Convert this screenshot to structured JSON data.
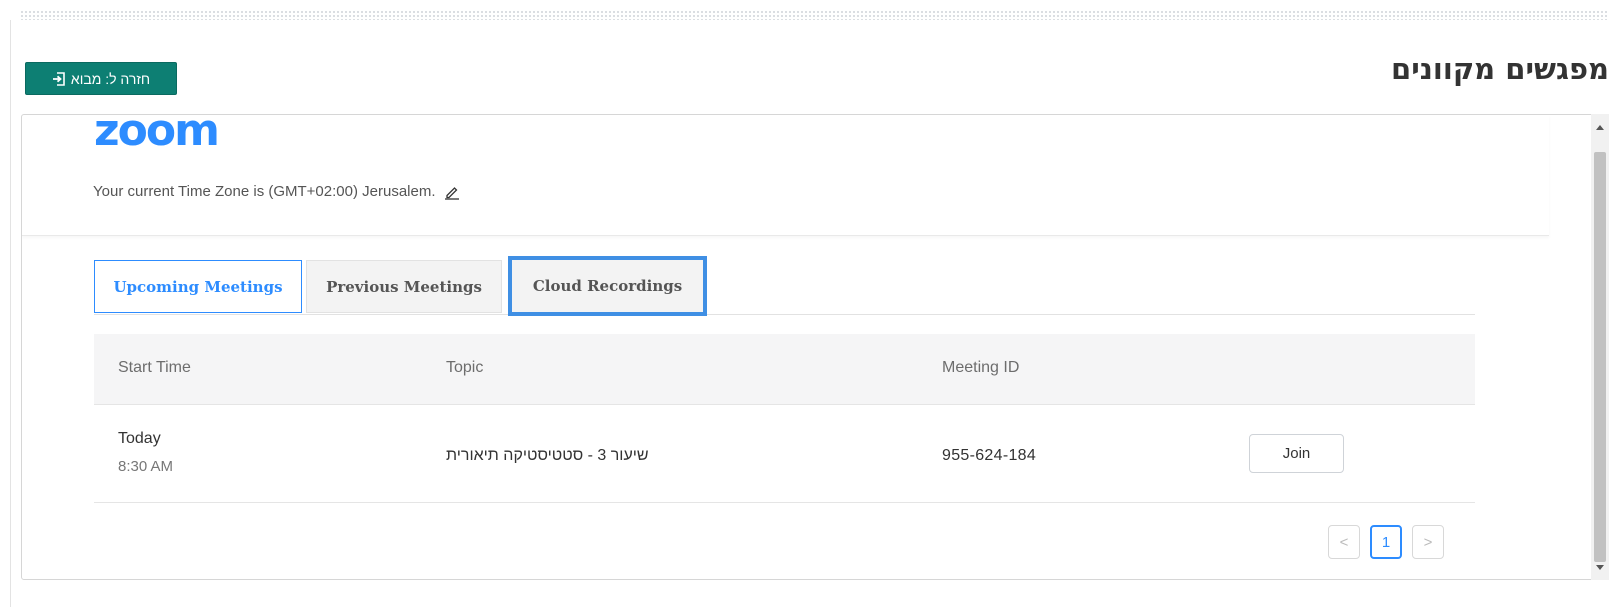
{
  "page": {
    "title": "מפגשים מקוונים",
    "back_button": {
      "label": "חזרה ל: מבוא",
      "icon": "sign-in-icon",
      "color": "#0d7f73"
    }
  },
  "zoom": {
    "logo": "zoom",
    "logo_color": "#2d8cff",
    "timezone_text": "Your current Time Zone is (GMT+02:00) Jerusalem.",
    "edit_icon": "pencil-icon"
  },
  "tabs": [
    {
      "label": "Upcoming Meetings",
      "state": "active"
    },
    {
      "label": "Previous Meetings",
      "state": "inactive"
    },
    {
      "label": "Cloud Recordings",
      "state": "highlighted"
    }
  ],
  "table": {
    "columns": [
      "Start Time",
      "Topic",
      "Meeting ID"
    ],
    "rows": [
      {
        "day": "Today",
        "time": "8:30 AM",
        "topic": "שיעור 3 - סטטיסטיקה תיאורית",
        "meeting_id": "955-624-184",
        "action": "Join"
      }
    ]
  },
  "pagination": {
    "prev": "<",
    "current": "1",
    "next": ">"
  },
  "colors": {
    "accent": "#2d8cff",
    "highlight_border": "#3f8fe4",
    "back_button": "#0d7f73"
  }
}
